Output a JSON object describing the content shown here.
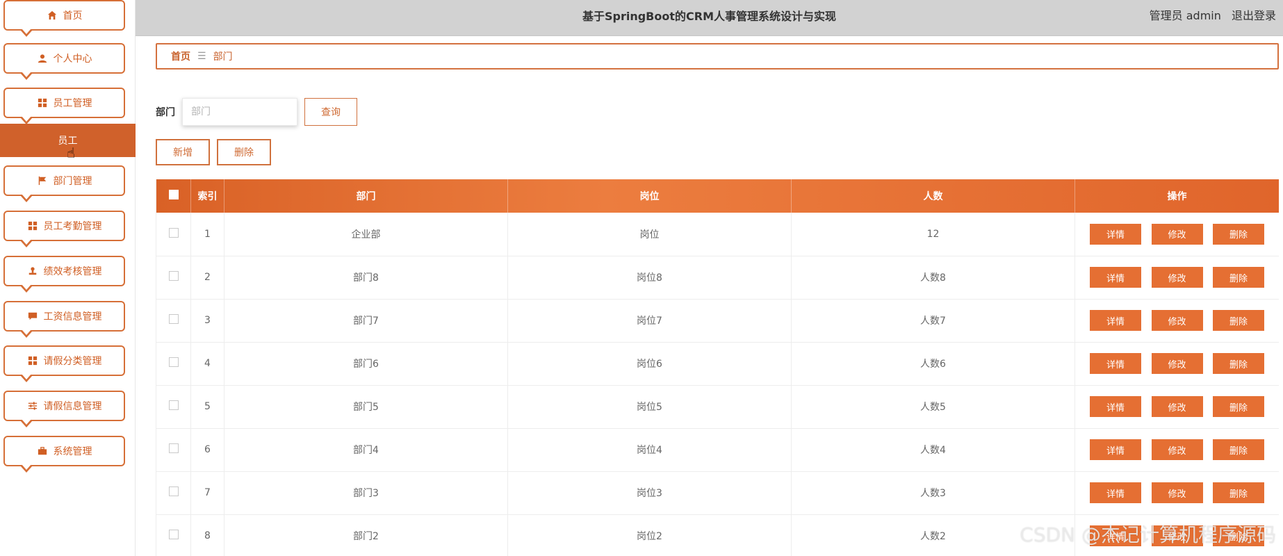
{
  "header": {
    "title": "基于SpringBoot的CRM人事管理系统设计与实现",
    "user_label": "管理员 admin",
    "logout": "退出登录"
  },
  "sidebar": {
    "items": [
      {
        "label": "首页",
        "icon": "home-icon"
      },
      {
        "label": "个人中心",
        "icon": "user-icon"
      },
      {
        "label": "员工管理",
        "icon": "grid-icon"
      },
      {
        "label": "部门管理",
        "icon": "flag-icon"
      },
      {
        "label": "员工考勤管理",
        "icon": "grid-icon"
      },
      {
        "label": "绩效考核管理",
        "icon": "stamp-icon"
      },
      {
        "label": "工资信息管理",
        "icon": "chat-icon"
      },
      {
        "label": "请假分类管理",
        "icon": "grid-icon"
      },
      {
        "label": "请假信息管理",
        "icon": "sliders-icon"
      },
      {
        "label": "系统管理",
        "icon": "briefcase-icon"
      }
    ],
    "active_sub": "员工"
  },
  "breadcrumb": {
    "home": "首页",
    "separator": "☰",
    "current": "部门"
  },
  "search": {
    "label": "部门",
    "placeholder": "部门",
    "value": "",
    "button": "查询"
  },
  "actions": {
    "add": "新增",
    "delete": "删除"
  },
  "table": {
    "columns": [
      "",
      "索引",
      "部门",
      "岗位",
      "人数",
      "操作"
    ],
    "rows": [
      {
        "index": "1",
        "dept": "企业部",
        "post": "岗位",
        "count": "12"
      },
      {
        "index": "2",
        "dept": "部门8",
        "post": "岗位8",
        "count": "人数8"
      },
      {
        "index": "3",
        "dept": "部门7",
        "post": "岗位7",
        "count": "人数7"
      },
      {
        "index": "4",
        "dept": "部门6",
        "post": "岗位6",
        "count": "人数6"
      },
      {
        "index": "5",
        "dept": "部门5",
        "post": "岗位5",
        "count": "人数5"
      },
      {
        "index": "6",
        "dept": "部门4",
        "post": "岗位4",
        "count": "人数4"
      },
      {
        "index": "7",
        "dept": "部门3",
        "post": "岗位3",
        "count": "人数3"
      },
      {
        "index": "8",
        "dept": "部门2",
        "post": "岗位2",
        "count": "人数2"
      }
    ],
    "op_labels": {
      "detail": "详情",
      "edit": "修改",
      "delete": "删除"
    }
  },
  "watermark": "CSDN @杰记计算机程序源码",
  "colors": {
    "accent": "#e56f33",
    "accent_dark": "#d0612b",
    "header_bg": "#d2d2d2"
  }
}
